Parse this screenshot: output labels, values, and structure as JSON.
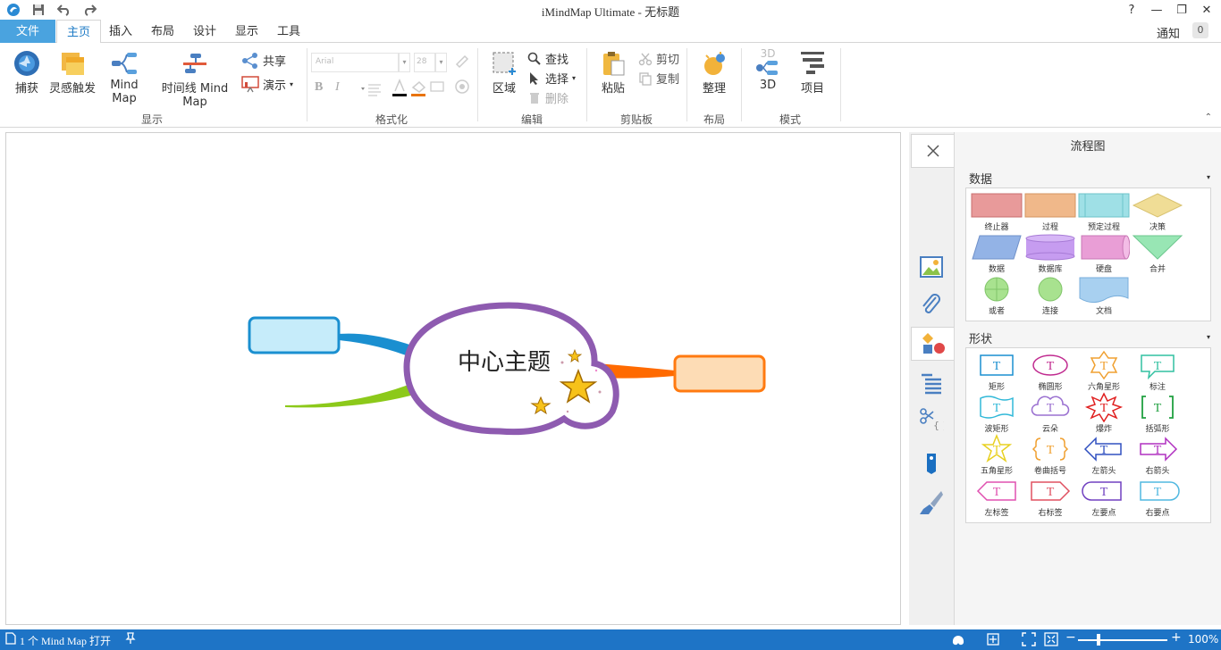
{
  "window": {
    "title": "iMindMap Ultimate - 无标题",
    "help": "?",
    "minimize": "—",
    "restore": "❐",
    "close": "✕"
  },
  "tabs": [
    {
      "label": "文件"
    },
    {
      "label": "主页"
    },
    {
      "label": "插入"
    },
    {
      "label": "布局"
    },
    {
      "label": "设计"
    },
    {
      "label": "显示"
    },
    {
      "label": "工具"
    }
  ],
  "notify": {
    "label": "通知",
    "count": "0"
  },
  "ribbon": {
    "capture": "捕获",
    "brainstorm": "灵感触发",
    "mindmap": "Mind Map",
    "timeline": "时间线 Mind Map",
    "share": "共享",
    "present": "演示",
    "group_display": "显示",
    "font_name": "Arial",
    "font_size": "28",
    "bold": "B",
    "italic": "I",
    "group_format": "格式化",
    "region": "区域",
    "find": "查找",
    "select": "选择",
    "delete": "删除",
    "group_edit": "编辑",
    "paste": "粘贴",
    "cut": "剪切",
    "copy": "复制",
    "group_clipboard": "剪贴板",
    "arrange": "整理",
    "group_layout": "布局",
    "threed": "3D",
    "project": "项目",
    "group_mode": "模式",
    "threed_badge": "3D"
  },
  "canvas": {
    "central_topic": "中心主题"
  },
  "panel": {
    "title": "流程图",
    "section_data": "数据",
    "section_shapes": "形状",
    "data_items": [
      "终止器",
      "过程",
      "预定过程",
      "决策",
      "数据",
      "数据库",
      "硬盘",
      "合并",
      "或者",
      "连接",
      "文档"
    ],
    "shape_items": [
      "矩形",
      "椭圆形",
      "六角星形",
      "标注",
      "波矩形",
      "云朵",
      "爆炸",
      "括弧形",
      "五角星形",
      "卷曲括号",
      "左箭头",
      "右箭头",
      "左标签",
      "右标签",
      "左要点",
      "右要点"
    ],
    "shape_glyph": "T"
  },
  "status": {
    "text": "1 个 Mind Map 打开",
    "zoom": "100%"
  },
  "colors": {
    "accent": "#1e74c6",
    "file_tab": "#4aa3df",
    "central_border": "#8e5bb0",
    "blue_branch": "#1a8fd0",
    "green_branch": "#8cc91a",
    "orange_branch": "#ff6a00"
  }
}
